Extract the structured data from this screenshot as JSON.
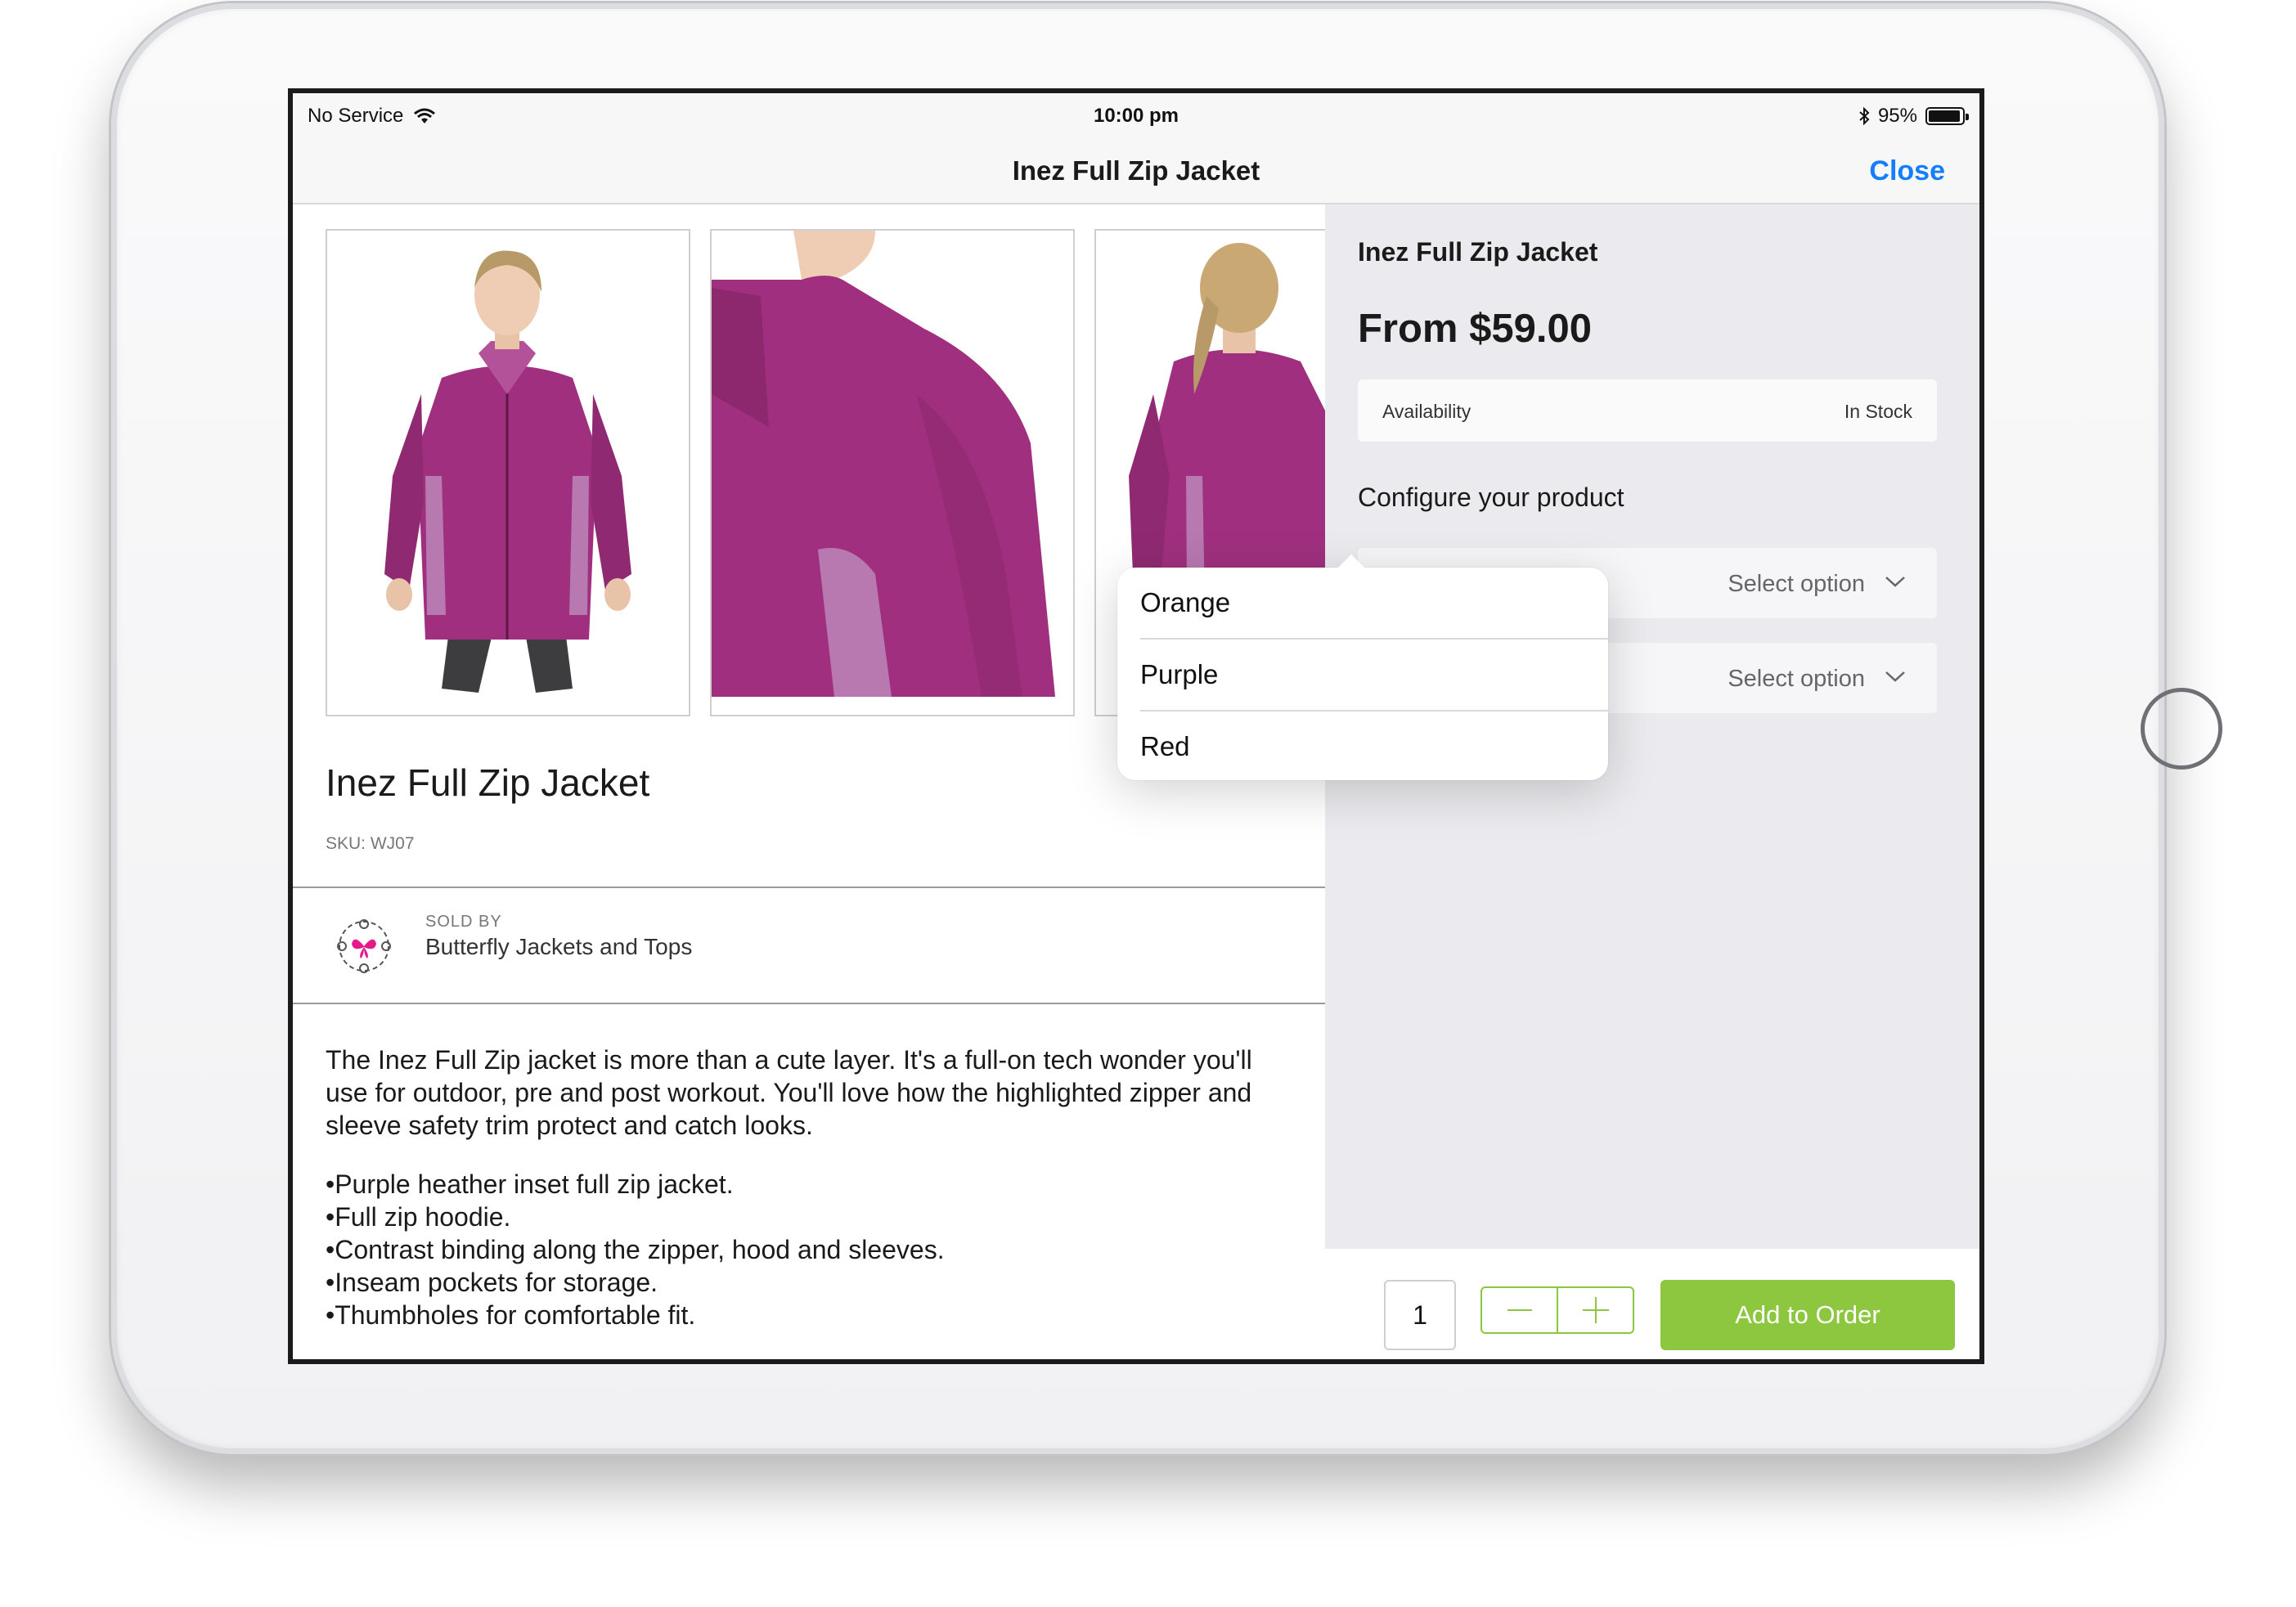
{
  "status_bar": {
    "carrier": "No Service",
    "time": "10:00 pm",
    "battery": "95%",
    "battery_level": 0.95
  },
  "nav": {
    "title": "Inez Full Zip Jacket",
    "close_label": "Close"
  },
  "product": {
    "name": "Inez Full Zip Jacket",
    "sku": "SKU: WJ07",
    "sold_by_label": "SOLD BY",
    "seller": "Butterfly Jackets and Tops",
    "description": "The Inez Full Zip jacket is more than a cute layer. It's a full-on tech wonder you'll use for outdoor, pre and post workout. You'll love how the highlighted zipper and sleeve safety trim protect and catch looks.",
    "features": [
      "Purple heather inset full zip jacket.",
      "Full zip hoodie.",
      "Contrast binding along the zipper, hood and sleeves.",
      "Inseam pockets for storage.",
      "Thumbholes for comfortable fit."
    ],
    "images": [
      "jacket-front",
      "jacket-shoulder-detail",
      "jacket-back"
    ]
  },
  "config_panel": {
    "title": "Inez Full Zip Jacket",
    "price": "From $59.00",
    "availability_label": "Availability",
    "availability_value": "In Stock",
    "configure_label": "Configure your product",
    "selects": [
      {
        "placeholder": "Select option"
      },
      {
        "placeholder": "Select option"
      }
    ]
  },
  "dropdown": {
    "options": [
      "Orange",
      "Purple",
      "Red"
    ]
  },
  "actions": {
    "quantity": "1",
    "add_label": "Add to Order"
  },
  "colors": {
    "accent_blue": "#147efb",
    "add_green": "#8dc63f",
    "jacket_purple": "#a0307f"
  }
}
